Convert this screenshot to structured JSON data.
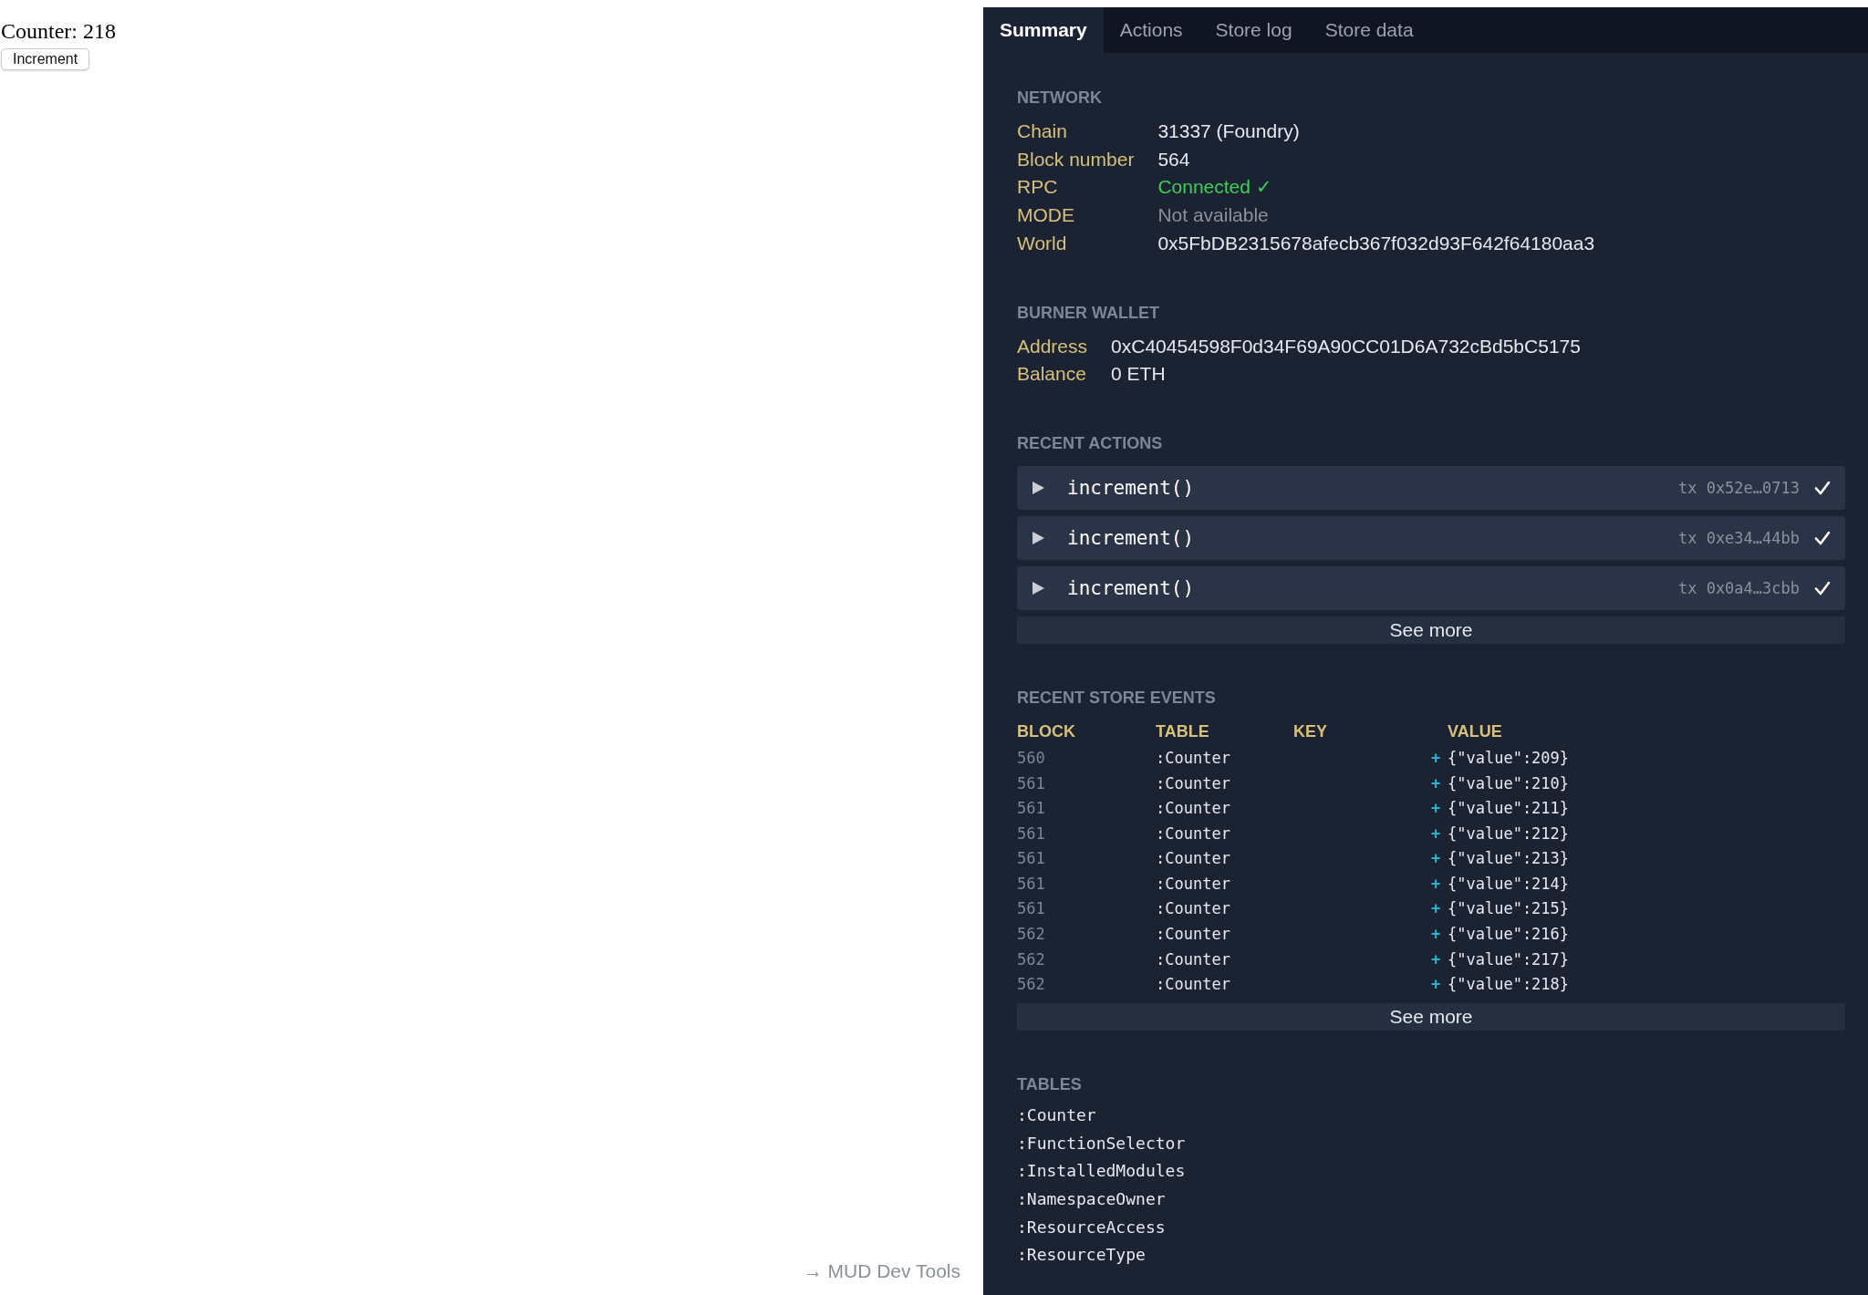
{
  "page": {
    "counter_text": "Counter: 218",
    "increment_button": "Increment",
    "devtools_link": "→ MUD Dev Tools"
  },
  "devtools": {
    "tabs": [
      {
        "label": "Summary",
        "selected": true
      },
      {
        "label": "Actions",
        "selected": false
      },
      {
        "label": "Store log",
        "selected": false
      },
      {
        "label": "Store data",
        "selected": false
      }
    ],
    "network": {
      "heading": "NETWORK",
      "rows": [
        {
          "label": "Chain",
          "value": "31337 (Foundry)",
          "kind": "normal"
        },
        {
          "label": "Block number",
          "value": "564",
          "kind": "normal"
        },
        {
          "label": "RPC",
          "value": "Connected ✓",
          "kind": "ok"
        },
        {
          "label": "MODE",
          "value": "Not available",
          "kind": "unavailable"
        },
        {
          "label": "World",
          "value": "0x5FbDB2315678afecb367f032d93F642f64180aa3",
          "kind": "normal"
        }
      ]
    },
    "burner_wallet": {
      "heading": "BURNER WALLET",
      "rows": [
        {
          "label": "Address",
          "value": "0xC40454598F0d34F69A90CC01D6A732cBd5bC5175"
        },
        {
          "label": "Balance",
          "value": "0 ETH"
        }
      ]
    },
    "recent_actions": {
      "heading": "RECENT ACTIONS",
      "items": [
        {
          "name": "increment()",
          "tx": "tx 0x52e…0713",
          "expanded": false,
          "kind": "success"
        },
        {
          "name": "increment()",
          "tx": "tx 0xe34…44bb",
          "expanded": false,
          "kind": "success"
        },
        {
          "name": "increment()",
          "tx": "tx 0x0a4…3cbb",
          "expanded": false,
          "kind": "success"
        }
      ],
      "see_more": "See more"
    },
    "recent_store_events": {
      "heading": "RECENT STORE EVENTS",
      "columns": [
        "BLOCK",
        "TABLE",
        "KEY",
        "VALUE"
      ],
      "rows": [
        {
          "block": "560",
          "table": ":Counter",
          "op": "+",
          "value": "{\"value\":209}"
        },
        {
          "block": "561",
          "table": ":Counter",
          "op": "+",
          "value": "{\"value\":210}"
        },
        {
          "block": "561",
          "table": ":Counter",
          "op": "+",
          "value": "{\"value\":211}"
        },
        {
          "block": "561",
          "table": ":Counter",
          "op": "+",
          "value": "{\"value\":212}"
        },
        {
          "block": "561",
          "table": ":Counter",
          "op": "+",
          "value": "{\"value\":213}"
        },
        {
          "block": "561",
          "table": ":Counter",
          "op": "+",
          "value": "{\"value\":214}"
        },
        {
          "block": "561",
          "table": ":Counter",
          "op": "+",
          "value": "{\"value\":215}"
        },
        {
          "block": "562",
          "table": ":Counter",
          "op": "+",
          "value": "{\"value\":216}"
        },
        {
          "block": "562",
          "table": ":Counter",
          "op": "+",
          "value": "{\"value\":217}"
        },
        {
          "block": "562",
          "table": ":Counter",
          "op": "+",
          "value": "{\"value\":218}"
        }
      ],
      "see_more": "See more"
    },
    "tables": {
      "heading": "TABLES",
      "items": [
        ":Counter",
        ":FunctionSelector",
        ":InstalledModules",
        ":NamespaceOwner",
        ":ResourceAccess",
        ":ResourceType"
      ]
    }
  }
}
